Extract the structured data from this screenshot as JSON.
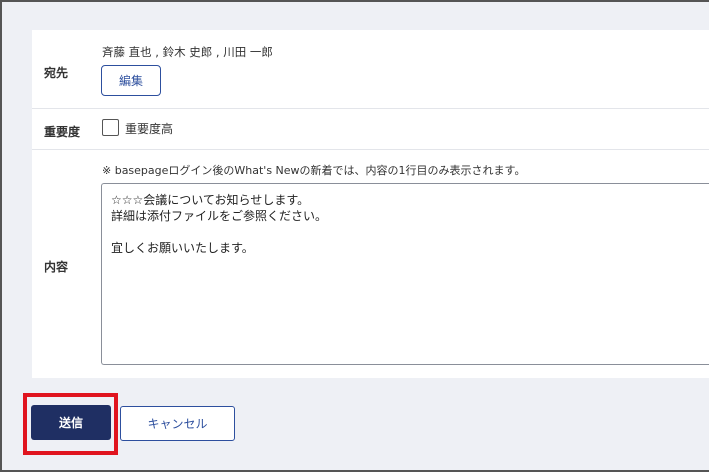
{
  "recipients": {
    "label": "宛先",
    "names": "斉藤 直也 , 鈴木 史郎 , 川田 一郎",
    "edit_label": "編集"
  },
  "importance": {
    "label": "重要度",
    "checkbox_label": "重要度高",
    "checked": false
  },
  "content": {
    "label": "内容",
    "note": "※ basepageログイン後のWhat's Newの新着では、内容の1行目のみ表示されます。",
    "body": "☆☆☆会議についてお知らせします。\n詳細は添付ファイルをご参照ください。\n\n宜しくお願いいたします。"
  },
  "actions": {
    "send_label": "送信",
    "cancel_label": "キャンセル"
  },
  "colors": {
    "primary": "#1f2f63",
    "link": "#2d4f9e",
    "highlight": "#e0141e",
    "background": "#eef0f5"
  }
}
